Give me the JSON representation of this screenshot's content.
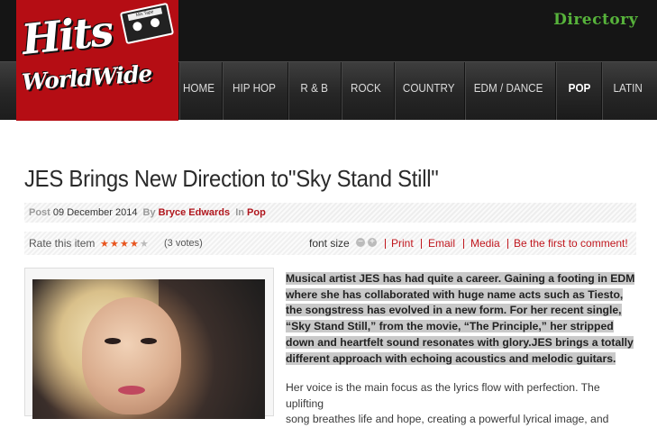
{
  "header": {
    "directory_label": "Directory",
    "logo": {
      "line1": "Hits",
      "line2": "WorldWide",
      "tape_label": "Mix Tape"
    }
  },
  "nav": {
    "items": [
      {
        "label": "HOME"
      },
      {
        "label": "HIP HOP"
      },
      {
        "label": "R & B"
      },
      {
        "label": "ROCK"
      },
      {
        "label": "COUNTRY"
      },
      {
        "label": "EDM / DANCE"
      },
      {
        "label": "POP"
      },
      {
        "label": "LATIN"
      }
    ],
    "active": "POP"
  },
  "article": {
    "title": "JES Brings New Direction to\"Sky Stand Still\"",
    "meta": {
      "post_label": "Post",
      "date": "09 December 2014",
      "by_label": "By",
      "author": "Bryce Edwards",
      "in_label": "In",
      "category": "Pop"
    },
    "toolbar": {
      "rate_label": "Rate this item",
      "rating": 4,
      "rating_max": 5,
      "votes": "(3 votes)",
      "font_size_label": "font size",
      "font_minus": "−",
      "font_plus": "+",
      "print": "Print",
      "email": "Email",
      "media": "Media",
      "comment": "Be the first to comment!"
    },
    "intro_lines": [
      "Musical artist JES has had quite a career. Gaining a footing in EDM",
      "where she has collaborated with huge name acts such as Tiesto,",
      "the songstress has evolved in a new form. For her recent single,",
      "“Sky Stand Still,” from the movie, “The Principle,” her stripped",
      "down and heartfelt sound resonates with glory.JES brings a totally",
      "different approach with echoing acoustics and melodic guitars."
    ],
    "body_lines": [
      "Her voice is the main focus as the lyrics flow with perfection. The uplifting",
      "song breathes life and hope, creating a powerful lyrical image, and"
    ]
  },
  "colors": {
    "accent": "#b50d14",
    "link": "#c0171e",
    "directory": "#57b33b",
    "star": "#e8541d"
  }
}
